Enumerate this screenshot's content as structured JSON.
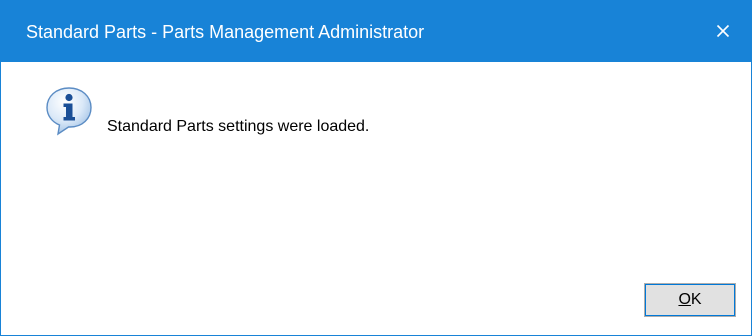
{
  "window": {
    "title": "Standard Parts - Parts Management Administrator",
    "close_icon": "close-icon",
    "titlebar_color": "#1883d7"
  },
  "dialog": {
    "icon": "information-icon",
    "message": "Standard Parts settings were loaded.",
    "ok_button": {
      "mnemonic": "O",
      "rest": "K"
    }
  }
}
